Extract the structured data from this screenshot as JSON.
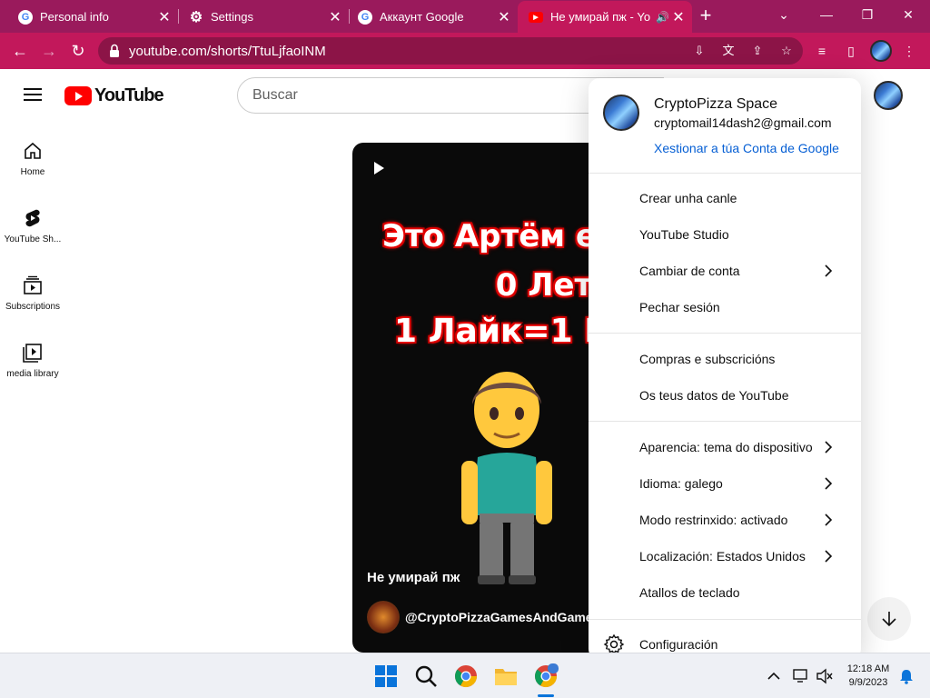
{
  "browser": {
    "tabs": [
      {
        "title": "Personal info",
        "icon": "google-g-icon"
      },
      {
        "title": "Settings",
        "icon": "gear-icon"
      },
      {
        "title": "Аккаунт Google",
        "icon": "google-g-icon"
      },
      {
        "title": "Не умирай пж - Yo",
        "icon": "youtube-icon",
        "active": true
      }
    ],
    "url": "youtube.com/shorts/TtuLjfaoINM",
    "colors": {
      "frame": "#9a1a5c",
      "toolbar": "#c2185b",
      "omnibox": "#8c1447"
    }
  },
  "youtube": {
    "logo_text": "YouTube",
    "search_placeholder": "Buscar",
    "guide": [
      {
        "label": "Home",
        "icon": "home-icon"
      },
      {
        "label": "YouTube Sh...",
        "icon": "shorts-icon"
      },
      {
        "label": "Subscriptions",
        "icon": "subscriptions-icon"
      },
      {
        "label": "media library",
        "icon": "library-icon"
      }
    ],
    "short": {
      "line1": "Это Артём ем",
      "line2": "0 Лет",
      "line3": "1 Лайк=1 Год",
      "caption": "Не умирай пж",
      "channel": "@CryptoPizzaGamesAndGames",
      "emoji": "person-standing-emoji"
    }
  },
  "account_menu": {
    "name": "CryptoPizza Space",
    "email": "cryptomail14dash2@gmail.com",
    "manage_link": "Xestionar a túa Conta de Google",
    "section1": [
      {
        "label": "Crear unha canle"
      },
      {
        "label": "YouTube Studio"
      },
      {
        "label": "Cambiar de conta",
        "chevron": true
      },
      {
        "label": "Pechar sesión"
      }
    ],
    "section2": [
      {
        "label": "Compras e subscricións"
      },
      {
        "label": "Os teus datos de YouTube"
      }
    ],
    "section3": [
      {
        "label": "Aparencia: tema do dispositivo",
        "chevron": true
      },
      {
        "label": "Idioma: galego",
        "chevron": true
      },
      {
        "label": "Modo restrinxido: activado",
        "chevron": true
      },
      {
        "label": "Localización: Estados Unidos",
        "chevron": true
      },
      {
        "label": "Atallos de teclado"
      }
    ],
    "section4": [
      {
        "label": "Configuración",
        "icon": "settings-gear-icon"
      }
    ]
  },
  "taskbar": {
    "time": "12:18 AM",
    "date": "9/9/2023",
    "apps": [
      "windows-start-icon",
      "search-icon",
      "chrome-icon",
      "file-explorer-icon",
      "chrome-profile-icon"
    ]
  }
}
